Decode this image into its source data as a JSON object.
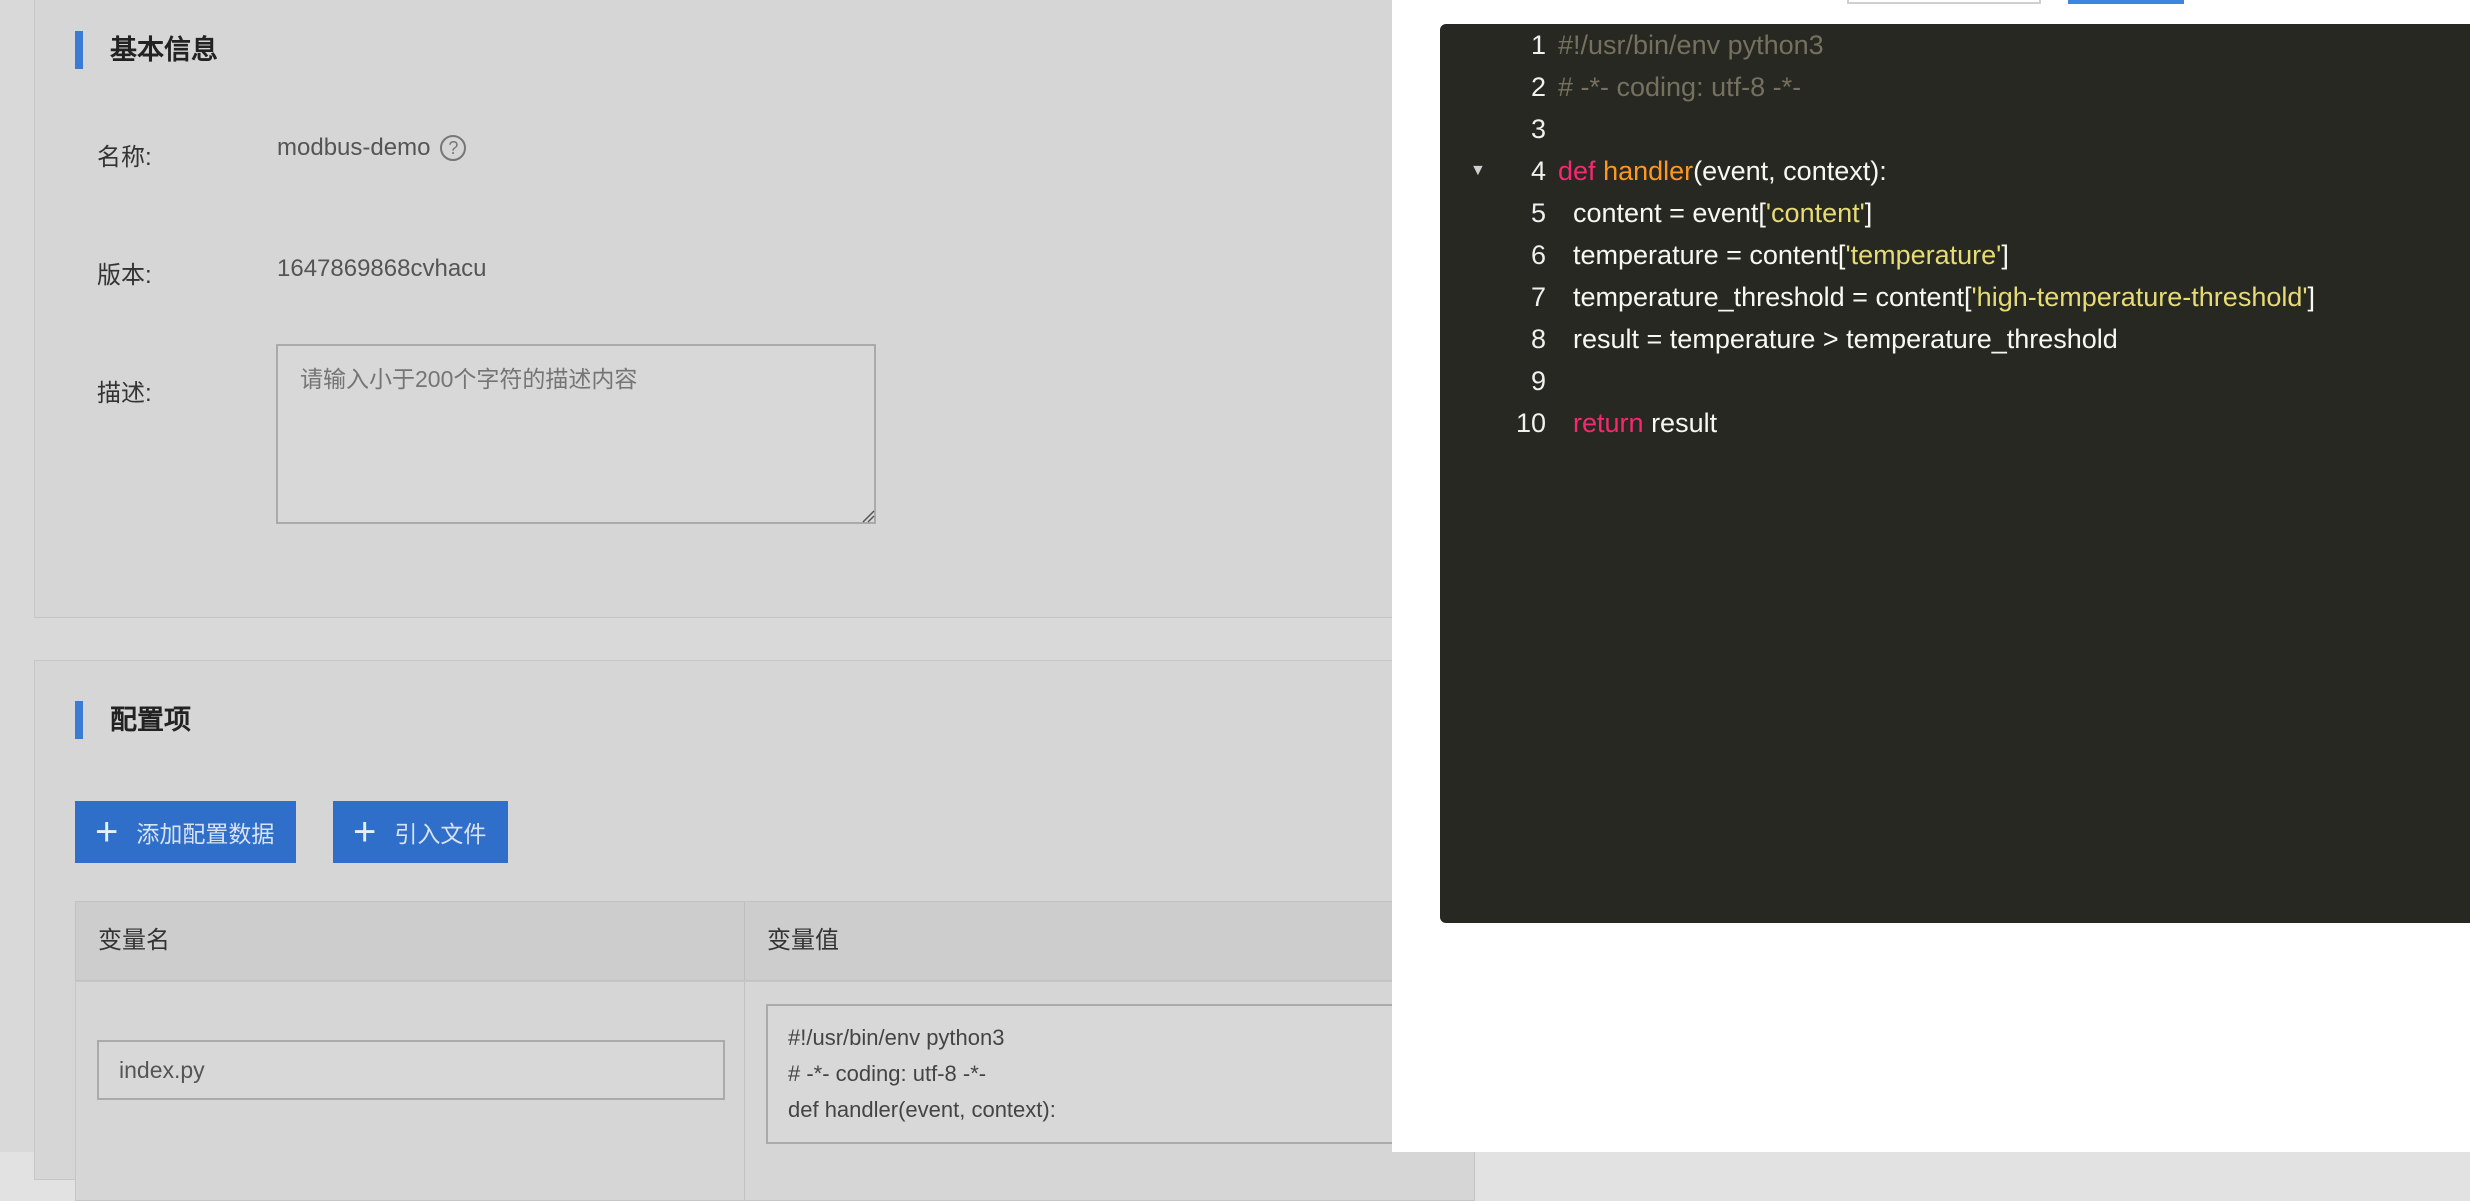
{
  "basic_info": {
    "title": "基本信息",
    "name_label": "名称:",
    "name_value": "modbus-demo",
    "version_label": "版本:",
    "version_value": "1647869868cvhacu",
    "description_label": "描述:",
    "description_placeholder": "请输入小于200个字符的描述内容"
  },
  "config": {
    "title": "配置项",
    "add_button": "添加配置数据",
    "import_button": "引入文件",
    "columns": [
      "变量名",
      "变量值"
    ],
    "rows": [
      {
        "name": "index.py",
        "value_lines": [
          "#!/usr/bin/env python3",
          "# -*- coding: utf-8 -*-",
          "",
          "def handler(event, context):"
        ]
      }
    ]
  },
  "editor": {
    "lines": [
      {
        "num": "1",
        "indent": "",
        "tokens": [
          {
            "t": "#!/usr/bin/env python3",
            "k": "comment"
          }
        ]
      },
      {
        "num": "2",
        "indent": "",
        "tokens": [
          {
            "t": "# -*- coding: utf-8 -*-",
            "k": "comment"
          }
        ]
      },
      {
        "num": "3",
        "indent": "",
        "tokens": []
      },
      {
        "num": "4",
        "indent": "",
        "fold": true,
        "tokens": [
          {
            "t": "def",
            "k": "kw"
          },
          {
            "t": " ",
            "k": ""
          },
          {
            "t": "handler",
            "k": "fn"
          },
          {
            "t": "(event, context):",
            "k": ""
          }
        ]
      },
      {
        "num": "5",
        "indent": "  ",
        "tokens": [
          {
            "t": "content = event[",
            "k": ""
          },
          {
            "t": "'content'",
            "k": "str"
          },
          {
            "t": "]",
            "k": ""
          }
        ]
      },
      {
        "num": "6",
        "indent": "  ",
        "tokens": [
          {
            "t": "temperature = content[",
            "k": ""
          },
          {
            "t": "'temperature'",
            "k": "str"
          },
          {
            "t": "]",
            "k": ""
          }
        ]
      },
      {
        "num": "7",
        "indent": "  ",
        "tokens": [
          {
            "t": "temperature_threshold = content[",
            "k": ""
          },
          {
            "t": "'high-temperature-threshold'",
            "k": "str"
          },
          {
            "t": "]",
            "k": ""
          }
        ]
      },
      {
        "num": "8",
        "indent": "  ",
        "tokens": [
          {
            "t": "result = temperature > temperature_threshold",
            "k": ""
          }
        ]
      },
      {
        "num": "9",
        "indent": "",
        "tokens": []
      },
      {
        "num": "10",
        "indent": "  ",
        "tokens": [
          {
            "t": "return",
            "k": "kw"
          },
          {
            "t": " result",
            "k": ""
          }
        ]
      }
    ]
  },
  "icons": {
    "help": "question-circle-icon",
    "plus": "plus-icon",
    "fold": "fold-arrow-icon"
  },
  "colors": {
    "accent": "#3a7bd5",
    "editor_bg": "#272822",
    "keyword": "#f92672",
    "function": "#fd971f",
    "string": "#e6db74",
    "comment": "#75715e"
  }
}
